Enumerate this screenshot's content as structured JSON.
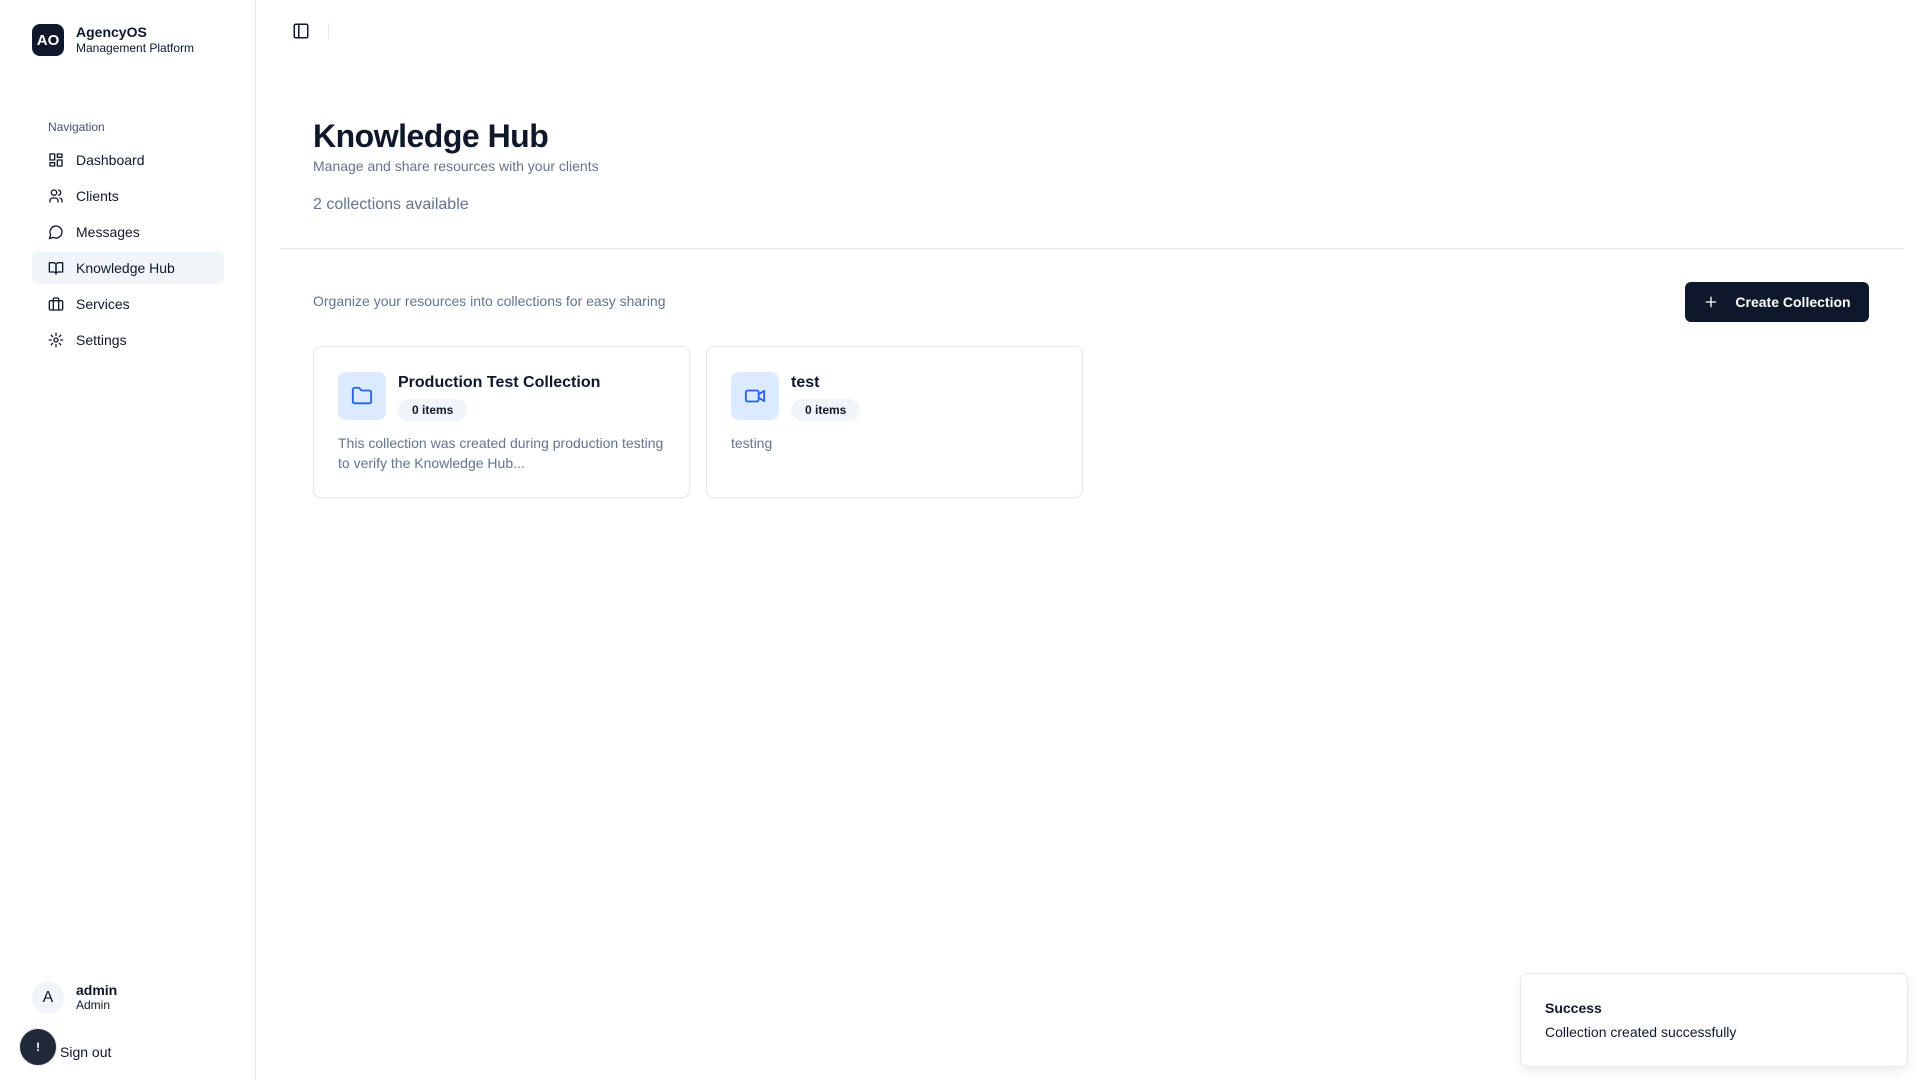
{
  "brand": {
    "logo": "AO",
    "name": "AgencyOS",
    "subtitle": "Management Platform"
  },
  "sidebar": {
    "group_label": "Navigation",
    "items": [
      {
        "label": "Dashboard",
        "icon": "dashboard-icon",
        "active": false
      },
      {
        "label": "Clients",
        "icon": "users-icon",
        "active": false
      },
      {
        "label": "Messages",
        "icon": "message-circle-icon",
        "active": false
      },
      {
        "label": "Knowledge Hub",
        "icon": "book-open-icon",
        "active": true
      },
      {
        "label": "Services",
        "icon": "briefcase-icon",
        "active": false
      },
      {
        "label": "Settings",
        "icon": "gear-icon",
        "active": false
      }
    ]
  },
  "user": {
    "initial": "A",
    "name": "admin",
    "role": "Admin",
    "signout_label": "Sign out",
    "alert_glyph": "!"
  },
  "page": {
    "title": "Knowledge Hub",
    "subtitle": "Manage and share resources with your clients",
    "count_text": "2 collections available",
    "organize_text": "Organize your resources into collections for easy sharing",
    "create_button_label": "Create Collection"
  },
  "collections": [
    {
      "title": "Production Test Collection",
      "badge": "0 items",
      "icon": "folder-icon",
      "description": "This collection was created during production testing to verify the Knowledge Hub..."
    },
    {
      "title": "test",
      "badge": "0 items",
      "icon": "video-icon",
      "description": "testing"
    }
  ],
  "toast": {
    "title": "Success",
    "message": "Collection created successfully"
  },
  "colors": {
    "primary": "#0f172a",
    "muted_text": "#64748b",
    "icon_bg": "#dbeafe",
    "icon_stroke": "#2563eb",
    "active_nav_bg": "#f1f5f9"
  }
}
